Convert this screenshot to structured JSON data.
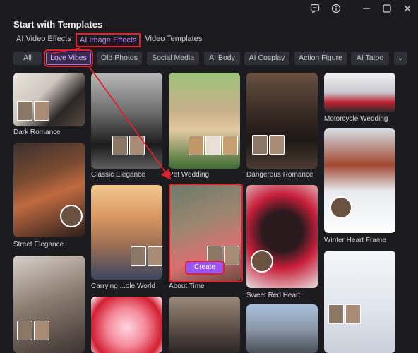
{
  "title": "Start with Templates",
  "window_controls": [
    "feedback-icon",
    "info-icon",
    "minimize-icon",
    "maximize-icon",
    "close-icon"
  ],
  "tabs": [
    {
      "label": "AI Video Effects",
      "active": false
    },
    {
      "label": "AI Image Effects",
      "active": true
    },
    {
      "label": "Video Templates",
      "active": false
    }
  ],
  "chips": [
    {
      "label": "All",
      "active": false
    },
    {
      "label": "Love Vibes",
      "active": true
    },
    {
      "label": "Old Photos",
      "active": false
    },
    {
      "label": "Social Media",
      "active": false
    },
    {
      "label": "AI Body",
      "active": false
    },
    {
      "label": "AI Cosplay",
      "active": false
    },
    {
      "label": "Action Figure",
      "active": false
    },
    {
      "label": "AI Tatoo",
      "active": false
    }
  ],
  "cards": [
    {
      "label": "Dark Romance"
    },
    {
      "label": "Street Elegance"
    },
    {
      "label": "Classic Elegance"
    },
    {
      "label": "Carrying ...ole World"
    },
    {
      "label": "Pet Wedding"
    },
    {
      "label": "About Time"
    },
    {
      "label": "Dangerous Romance"
    },
    {
      "label": "Sweet Red Heart"
    },
    {
      "label": "Motorcycle Wedding"
    },
    {
      "label": "Winter Heart Frame"
    }
  ],
  "create_button": "Create",
  "colors": {
    "accent": "#9a55f5",
    "annotation": "#e0202a",
    "background": "#1b1b20"
  }
}
